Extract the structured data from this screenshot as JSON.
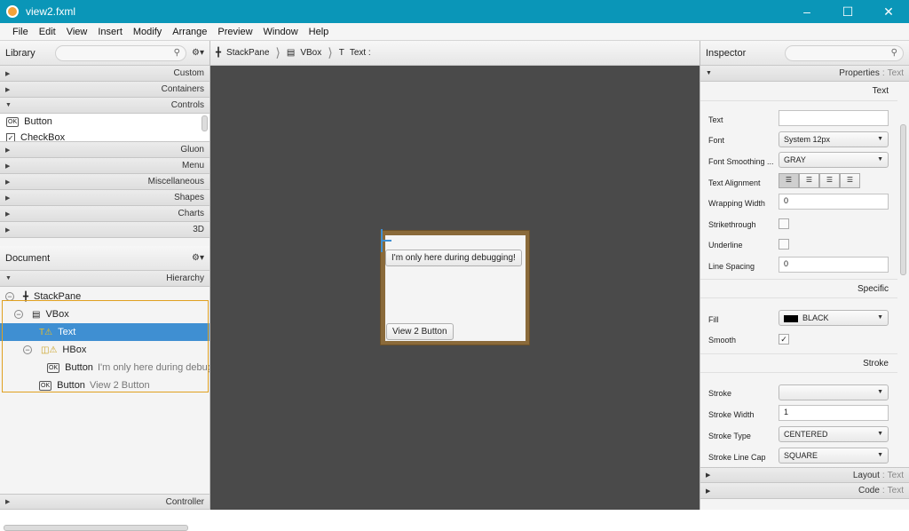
{
  "window": {
    "title": "view2.fxml",
    "minimize": "–",
    "maximize": "☐",
    "close": "✕"
  },
  "menu": [
    "File",
    "Edit",
    "View",
    "Insert",
    "Modify",
    "Arrange",
    "Preview",
    "Window",
    "Help"
  ],
  "library": {
    "title": "Library",
    "sections_top": [
      "Custom",
      "Containers",
      "Controls"
    ],
    "items": [
      {
        "label": "Button",
        "icon": "ok-icon"
      },
      {
        "label": "CheckBox",
        "icon": "checkbox-icon"
      }
    ],
    "sections_bottom": [
      "Gluon",
      "Menu",
      "Miscellaneous",
      "Shapes",
      "Charts",
      "3D"
    ]
  },
  "document": {
    "title": "Document",
    "section": "Hierarchy",
    "tree": [
      {
        "label": "StackPane",
        "extra": ""
      },
      {
        "label": "VBox",
        "extra": ""
      },
      {
        "label": "Text",
        "extra": ""
      },
      {
        "label": "HBox",
        "extra": ""
      },
      {
        "label": "Button",
        "extra": "I'm only here during debugging!"
      },
      {
        "label": "Button",
        "extra": "View 2 Button"
      }
    ],
    "footer": "Controller"
  },
  "breadcrumb": [
    "StackPane",
    "VBox",
    "Text :"
  ],
  "canvas": {
    "debug_button": "I'm only here during debugging!",
    "view_button": "View 2 Button"
  },
  "inspector": {
    "title": "Inspector",
    "properties_label": "Properties",
    "properties_target": "Text",
    "text_section": "Text",
    "text_props": {
      "text_label": "Text",
      "text_value": "",
      "font_label": "Font",
      "font_value": "System 12px",
      "smoothing_label": "Font Smoothing ...",
      "smoothing_value": "GRAY",
      "alignment_label": "Text Alignment",
      "wrapping_label": "Wrapping Width",
      "wrapping_value": "0",
      "strike_label": "Strikethrough",
      "underline_label": "Underline",
      "spacing_label": "Line Spacing",
      "spacing_value": "0"
    },
    "specific_section": "Specific",
    "specific_props": {
      "fill_label": "Fill",
      "fill_value": "BLACK",
      "fill_color": "#000000",
      "smooth_label": "Smooth",
      "smooth_mark": "✓"
    },
    "stroke_section": "Stroke",
    "stroke_props": {
      "stroke_label": "Stroke",
      "stroke_value": "",
      "width_label": "Stroke Width",
      "width_value": "1",
      "type_label": "Stroke Type",
      "type_value": "CENTERED",
      "cap_label": "Stroke Line Cap",
      "cap_value": "SQUARE"
    },
    "layout_label": "Layout",
    "layout_target": "Text",
    "code_label": "Code",
    "code_target": "Text"
  }
}
